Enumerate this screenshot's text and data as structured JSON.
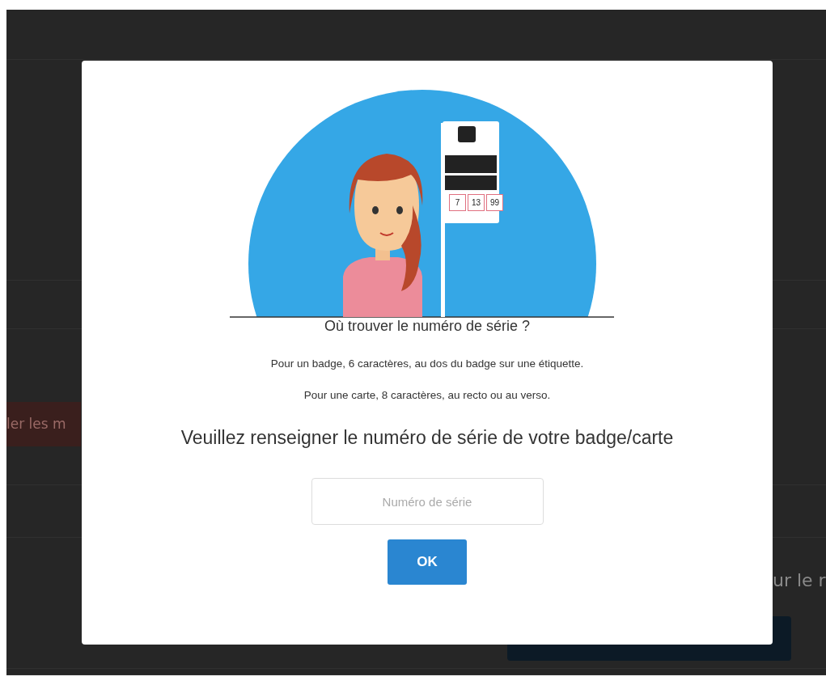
{
  "background": {
    "left_button": "ler les m",
    "right_text": "ur le r"
  },
  "modal": {
    "sign_numbers": [
      "7",
      "13",
      "99"
    ],
    "title": "Où trouver le numéro de série ?",
    "paragraphs": [
      "Pour un badge, 6 caractères, au dos du badge sur une étiquette.",
      "Pour une carte, 8 caractères, au recto ou au verso."
    ],
    "prompt": "Veuillez renseigner le numéro de série de votre badge/carte",
    "field": {
      "placeholder": "Numéro de série"
    },
    "button": "OK"
  }
}
